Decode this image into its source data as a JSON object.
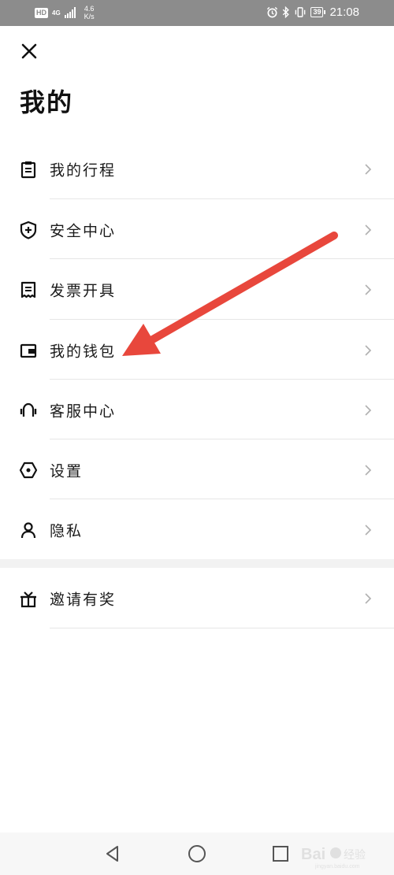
{
  "status_bar": {
    "hd": "HD",
    "network": "4G",
    "speed_value": "4.6",
    "speed_unit": "K/s",
    "battery": "39",
    "time": "21:08",
    "icons": [
      "alarm-icon",
      "bluetooth-icon",
      "vibrate-icon",
      "battery-icon"
    ]
  },
  "header": {
    "close_icon": "close-icon",
    "title": "我的"
  },
  "menu": {
    "items": [
      {
        "label": "我的行程",
        "icon": "clipboard-icon"
      },
      {
        "label": "安全中心",
        "icon": "shield-plus-icon"
      },
      {
        "label": "发票开具",
        "icon": "invoice-icon"
      },
      {
        "label": "我的钱包",
        "icon": "wallet-icon"
      },
      {
        "label": "客服中心",
        "icon": "headset-icon"
      },
      {
        "label": "设置",
        "icon": "settings-hexagon-icon"
      },
      {
        "label": "隐私",
        "icon": "person-icon"
      }
    ],
    "extra": [
      {
        "label": "邀请有奖",
        "icon": "gift-icon"
      }
    ]
  },
  "annotation": {
    "color": "#e8473c",
    "points_to": "我的钱包"
  },
  "nav_bar": {
    "icons": [
      "back-icon",
      "home-icon",
      "recents-icon"
    ]
  },
  "watermark": {
    "text": "Bai 经验",
    "subtext": "jingyan.baidu.com"
  }
}
